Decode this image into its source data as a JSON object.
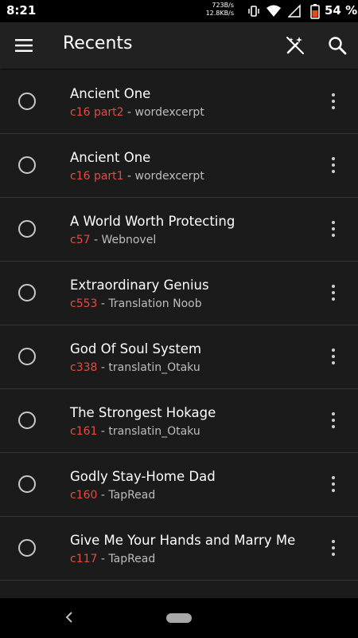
{
  "status_bar": {
    "time": "8:21",
    "net_up": "723B/s",
    "net_down": "12.8KB/s",
    "battery_pct": "54 %"
  },
  "toolbar": {
    "title": "Recents",
    "menu_icon": "hamburger-menu-icon",
    "magic_icon": "auto-fix-off-icon",
    "search_icon": "search-icon"
  },
  "colors": {
    "accent": "#e84a3f",
    "background": "#1b1b1b",
    "toolbar": "#212121"
  },
  "recents": [
    {
      "title": "Ancient One",
      "chapter": "c16 part2",
      "source": " - wordexcerpt"
    },
    {
      "title": "Ancient One",
      "chapter": "c16 part1",
      "source": " - wordexcerpt"
    },
    {
      "title": "A World Worth Protecting",
      "chapter": "c57",
      "source": " - Webnovel"
    },
    {
      "title": "Extraordinary Genius",
      "chapter": "c553",
      "source": " - Translation Noob"
    },
    {
      "title": "God Of Soul System",
      "chapter": "c338",
      "source": " - translatin_Otaku"
    },
    {
      "title": "The Strongest Hokage",
      "chapter": "c161",
      "source": " - translatin_Otaku"
    },
    {
      "title": "Godly Stay-Home Dad",
      "chapter": "c160",
      "source": " - TapRead"
    },
    {
      "title": "Give Me Your Hands and Marry Me",
      "chapter": "c117",
      "source": " - TapRead"
    }
  ]
}
